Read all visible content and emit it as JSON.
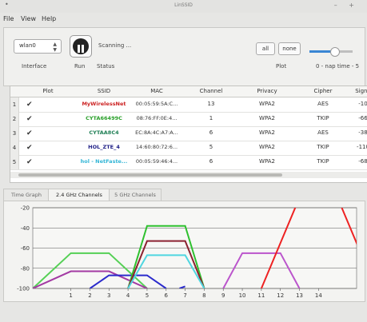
{
  "window": {
    "title": "LinSSID",
    "menu_glyph": "•",
    "controls": "– +"
  },
  "menubar": {
    "items": [
      "File",
      "View",
      "Help"
    ]
  },
  "toolbar": {
    "interface_value": "wlan0",
    "interface_caption": "Interface",
    "run_caption": "Run",
    "status_caption": "Status",
    "status_text": "Scanning ...",
    "all_label": "all",
    "none_label": "none",
    "plot_caption": "Plot",
    "nap_caption": "0 - nap time - 5",
    "nap_level": 0.55
  },
  "table": {
    "columns": [
      "Plot",
      "SSID",
      "MAC",
      "Channel",
      "Privacy",
      "Cipher",
      "Signa"
    ],
    "rows": [
      {
        "num": "1",
        "ssid": "MyWirelessNet",
        "ssid_color": "#cc2222",
        "mac": "00:05:59:5A:C...",
        "channel": "13",
        "privacy": "WPA2",
        "cipher": "AES",
        "signal": "-10"
      },
      {
        "num": "2",
        "ssid": "CYTA66499C",
        "ssid_color": "#2aa02a",
        "mac": "08:76:FF:0E:4...",
        "channel": "1",
        "privacy": "WPA2",
        "cipher": "TKIP",
        "signal": "-66"
      },
      {
        "num": "3",
        "ssid": "CYTAA8C4",
        "ssid_color": "#1f7f55",
        "mac": "EC:8A:4C:A7:A...",
        "channel": "6",
        "privacy": "WPA2",
        "cipher": "AES",
        "signal": "-38"
      },
      {
        "num": "4",
        "ssid": "HOL_ZTE_4",
        "ssid_color": "#222288",
        "mac": "14:60:80:72:6...",
        "channel": "5",
        "privacy": "WPA2",
        "cipher": "TKIP",
        "signal": "-110"
      },
      {
        "num": "5",
        "ssid": "hol - NetFaste...",
        "ssid_color": "#35b6d6",
        "mac": "00:05:59:46:4...",
        "channel": "6",
        "privacy": "WPA2",
        "cipher": "TKIP",
        "signal": "-68"
      }
    ]
  },
  "tabs": [
    "Time Graph",
    "2.4 GHz Channels",
    "5 GHz Channels"
  ],
  "active_tab": "2.4 GHz Channels",
  "chart_data": {
    "type": "line",
    "ylim": [
      -100,
      -20
    ],
    "xlim": [
      -1,
      16
    ],
    "yticks": [
      -20,
      -40,
      -60,
      -80,
      -100
    ],
    "xticks": [
      1,
      2,
      3,
      4,
      5,
      6,
      7,
      8,
      9,
      10,
      11,
      12,
      13,
      14
    ],
    "grid": true,
    "series": [
      {
        "color": "#55d055",
        "x": [
          -1,
          1,
          3,
          5
        ],
        "y": [
          -100,
          -65,
          -65,
          -100
        ]
      },
      {
        "color": "#a33aa3",
        "x": [
          -1,
          1,
          3,
          5
        ],
        "y": [
          -100,
          -83,
          -83,
          -100
        ]
      },
      {
        "color": "#2b2bcc",
        "x": [
          2,
          3,
          5,
          6
        ],
        "y": [
          -100,
          -87,
          -87,
          -100
        ]
      },
      {
        "color": "#2b2bcc",
        "x": [
          6.7,
          7
        ],
        "y": [
          -100,
          -98
        ]
      },
      {
        "color": "#2ec02e",
        "x": [
          4,
          5,
          7,
          8
        ],
        "y": [
          -100,
          -38,
          -38,
          -100
        ]
      },
      {
        "color": "#8b2231",
        "x": [
          4,
          5,
          7,
          8
        ],
        "y": [
          -100,
          -53,
          -53,
          -100
        ]
      },
      {
        "color": "#4fd6e0",
        "x": [
          4,
          5,
          7,
          8
        ],
        "y": [
          -100,
          -67,
          -67,
          -100
        ]
      },
      {
        "color": "#bb55cc",
        "x": [
          9,
          10,
          12,
          13
        ],
        "y": [
          -100,
          -65,
          -65,
          -100
        ]
      },
      {
        "color": "#ee2222",
        "x": [
          11,
          13,
          15,
          17
        ],
        "y": [
          -100,
          -10,
          -10,
          -100
        ]
      }
    ]
  }
}
